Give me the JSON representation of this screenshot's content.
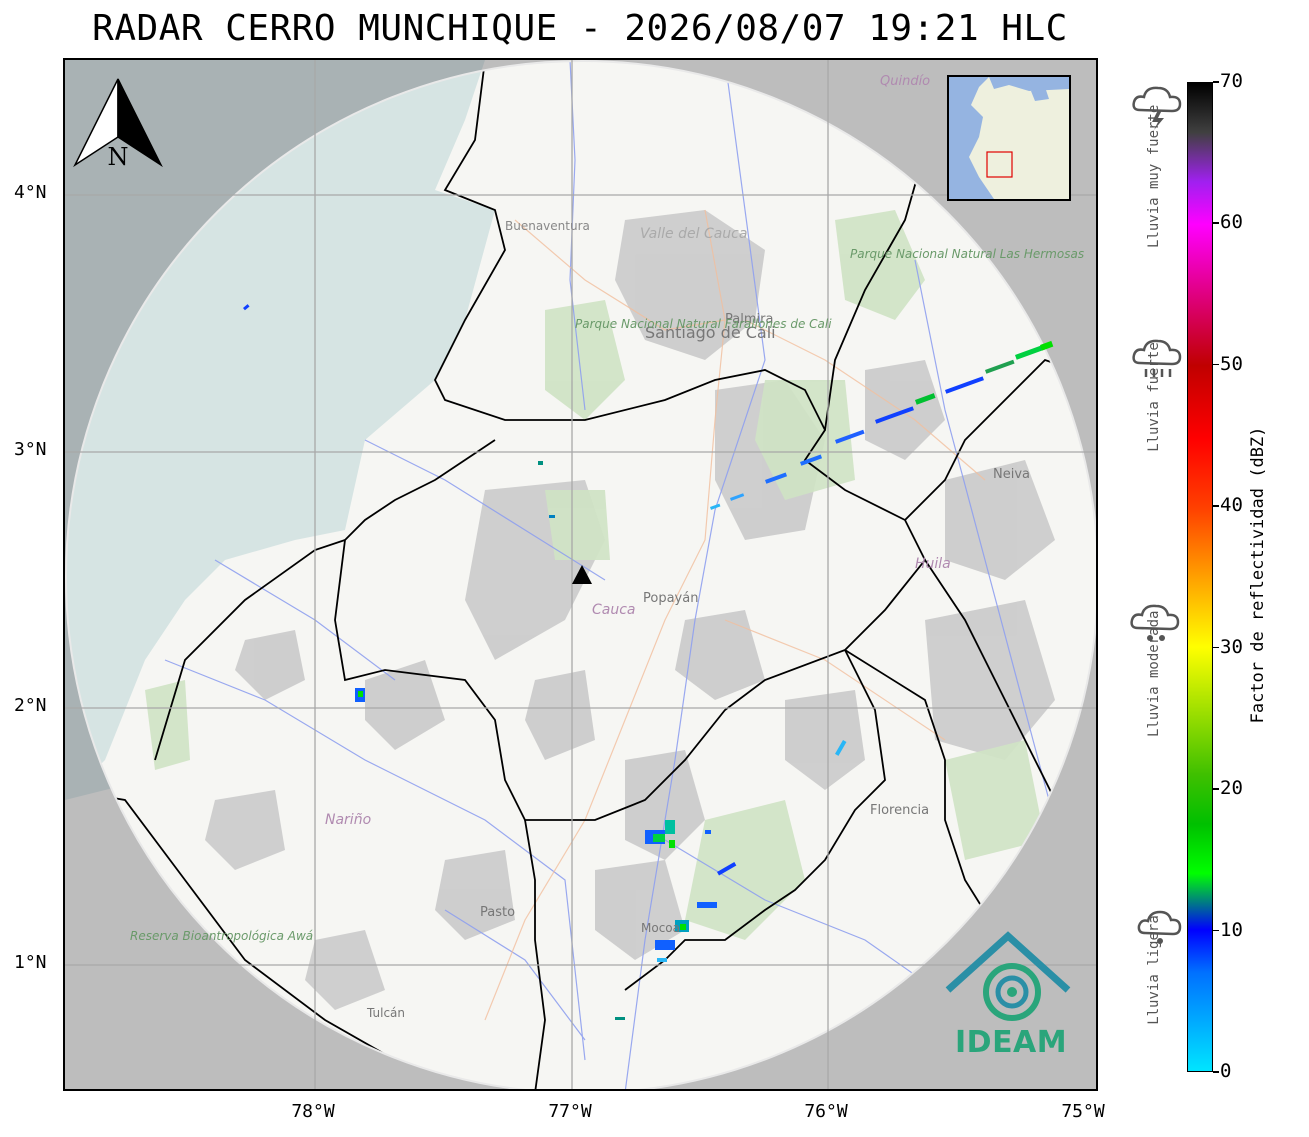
{
  "title": "RADAR CERRO MUNCHIQUE - 2026/08/07 19:21 HLC",
  "axes": {
    "lat_labels": [
      "4°N",
      "3°N",
      "2°N",
      "1°N"
    ],
    "lon_labels": [
      "78°W",
      "77°W",
      "76°W",
      "75°W"
    ]
  },
  "north_arrow": {
    "letter": "N"
  },
  "places": {
    "buenaventura": "Buenaventura",
    "valle": "Valle del Cauca",
    "cali": "Santiago de Cali",
    "palmira": "Palmira",
    "farallones": "Parque Nacional Natural Farallones de Cali",
    "hermosas": "Parque Nacional Natural Las Hermosas",
    "popayan": "Popayán",
    "cauca": "Cauca",
    "huila": "Huila",
    "neiva": "Neiva",
    "narino": "Nariño",
    "pasto": "Pasto",
    "florencia": "Florencia",
    "quindio": "Quindío",
    "reserva": "Reserva Bioantropológica Awá",
    "tulcan": "Tulcán",
    "mocoa": "Mocoa"
  },
  "logo": {
    "text": "IDEAM"
  },
  "colorbar": {
    "title": "Factor de reflectividad (dBZ)",
    "ticks": [
      "0",
      "10",
      "20",
      "30",
      "40",
      "50",
      "60",
      "70"
    ],
    "min": 0,
    "max": 70
  },
  "rain_categories": [
    {
      "label": "Lluvia muy fuerte",
      "icon": "storm-cloud-icon"
    },
    {
      "label": "Lluvia fuerte",
      "icon": "heavy-rain-cloud-icon"
    },
    {
      "label": "Lluvia moderada",
      "icon": "moderate-rain-cloud-icon"
    },
    {
      "label": "Lluvia ligera",
      "icon": "light-rain-cloud-icon"
    }
  ],
  "colors": {
    "ocean": "#d6e4e3",
    "land": "#f6f6f3",
    "outside_range": "#bdbdbd",
    "logo": "#2aa57b"
  }
}
